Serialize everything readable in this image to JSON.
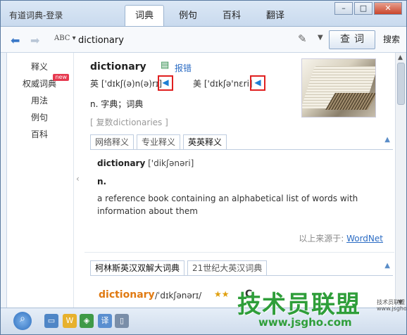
{
  "app_title": "有道词典-登录",
  "tabs": [
    "词典",
    "例句",
    "百科",
    "翻译"
  ],
  "window_buttons": {
    "minimize": "–",
    "maximize": "□",
    "close": "✕"
  },
  "toolbar": {
    "back_icon": "back-arrow-icon",
    "forward_icon": "forward-arrow-icon",
    "input_mode": "ABC",
    "search_value": "dictionary",
    "lookup_label": "查词",
    "search_label": "搜索"
  },
  "sidebar": {
    "items": [
      {
        "label": "释义"
      },
      {
        "label": "权威词典",
        "badge": "new"
      },
      {
        "label": "用法"
      },
      {
        "label": "例句"
      },
      {
        "label": "百科"
      }
    ]
  },
  "entry": {
    "word": "dictionary",
    "wordbook_label": "报错",
    "uk_prefix": "英",
    "uk_phonetic": "['dɪkʃ(ə)n(ə)rɪ]",
    "us_prefix": "美",
    "us_phonetic": "['dɪkʃə'nɛri]",
    "definition_cn": "n. 字典；词典",
    "plural": "[ 复数dictionaries ]"
  },
  "def_tabs": [
    "网络释义",
    "专业释义",
    "英英释义"
  ],
  "english": {
    "headword": "dictionary",
    "phonetic": "['dikʃənəri]",
    "pos": "n.",
    "gloss": "a reference book containing an alphabetical list of words with information about them",
    "source_prefix": "以上来源于:",
    "source_link": "WordNet"
  },
  "collins_tabs": [
    "柯林斯英汉双解大词典",
    "21世纪大英汉词典"
  ],
  "collins": {
    "word": "dictionary",
    "phonetic": "/ˈdɪkʃənərɪ/",
    "stars": "★★",
    "trailing": "C"
  },
  "watermark": {
    "main": "技术员联盟",
    "url": "www.jsgho.com",
    "side": "技术员联盟 www.jsgho.com"
  },
  "colors": {
    "accent": "#2b6cc4",
    "highlight": "#e07a12",
    "speaker_box": "#e02020",
    "watermark": "#2f9e3a"
  }
}
